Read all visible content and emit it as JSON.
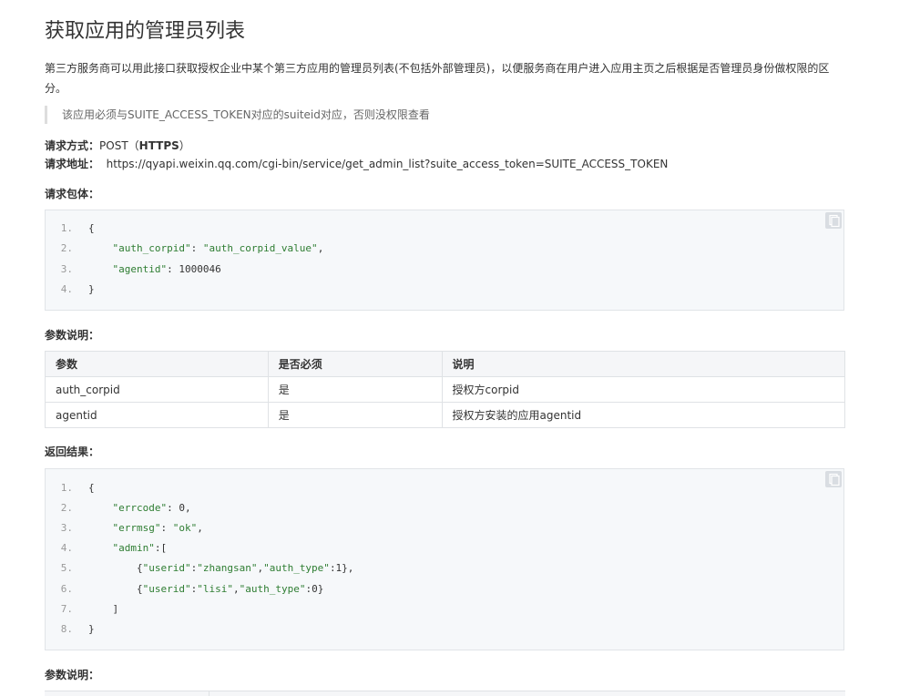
{
  "title": "获取应用的管理员列表",
  "intro": "第三方服务商可以用此接口获取授权企业中某个第三方应用的管理员列表(不包括外部管理员)，以便服务商在用户进入应用主页之后根据是否管理员身份做权限的区分。",
  "note": "该应用必须与SUITE_ACCESS_TOKEN对应的suiteid对应，否则没权限查看",
  "request": {
    "method_label": "请求方式：",
    "method": "POST（",
    "method_proto": "HTTPS",
    "method_close": "）",
    "url_label": "请求地址：",
    "url": "https://qyapi.weixin.qq.com/cgi-bin/service/get_admin_list?suite_access_token=SUITE_ACCESS_TOKEN"
  },
  "body_label": "请求包体：",
  "body_code": [
    {
      "n": "1.",
      "parts": [
        {
          "t": "{",
          "c": "pun"
        }
      ]
    },
    {
      "n": "2.",
      "parts": [
        {
          "t": "    ",
          "c": "pun"
        },
        {
          "t": "\"auth_corpid\"",
          "c": "str"
        },
        {
          "t": ": ",
          "c": "pun"
        },
        {
          "t": "\"auth_corpid_value\"",
          "c": "str"
        },
        {
          "t": ",",
          "c": "pun"
        }
      ]
    },
    {
      "n": "3.",
      "parts": [
        {
          "t": "    ",
          "c": "pun"
        },
        {
          "t": "\"agentid\"",
          "c": "str"
        },
        {
          "t": ": ",
          "c": "pun"
        },
        {
          "t": "1000046",
          "c": "num"
        }
      ]
    },
    {
      "n": "4.",
      "parts": [
        {
          "t": "}",
          "c": "pun"
        }
      ]
    }
  ],
  "params_label": "参数说明：",
  "params_table": {
    "headers": [
      "参数",
      "是否必须",
      "说明"
    ],
    "rows": [
      [
        "auth_corpid",
        "是",
        "授权方corpid"
      ],
      [
        "agentid",
        "是",
        "授权方安装的应用agentid"
      ]
    ]
  },
  "result_label": "返回结果：",
  "result_code": [
    {
      "n": "1.",
      "parts": [
        {
          "t": "{",
          "c": "pun"
        }
      ]
    },
    {
      "n": "2.",
      "parts": [
        {
          "t": "    ",
          "c": "pun"
        },
        {
          "t": "\"errcode\"",
          "c": "str"
        },
        {
          "t": ": 0,",
          "c": "pun"
        }
      ]
    },
    {
      "n": "3.",
      "parts": [
        {
          "t": "    ",
          "c": "pun"
        },
        {
          "t": "\"errmsg\"",
          "c": "str"
        },
        {
          "t": ": ",
          "c": "pun"
        },
        {
          "t": "\"ok\"",
          "c": "str"
        },
        {
          "t": ",",
          "c": "pun"
        }
      ]
    },
    {
      "n": "4.",
      "parts": [
        {
          "t": "    ",
          "c": "pun"
        },
        {
          "t": "\"admin\"",
          "c": "str"
        },
        {
          "t": ":[",
          "c": "pun"
        }
      ]
    },
    {
      "n": "5.",
      "parts": [
        {
          "t": "        {",
          "c": "pun"
        },
        {
          "t": "\"userid\"",
          "c": "str"
        },
        {
          "t": ":",
          "c": "pun"
        },
        {
          "t": "\"zhangsan\"",
          "c": "str"
        },
        {
          "t": ",",
          "c": "pun"
        },
        {
          "t": "\"auth_type\"",
          "c": "str"
        },
        {
          "t": ":1},",
          "c": "pun"
        }
      ]
    },
    {
      "n": "6.",
      "parts": [
        {
          "t": "        {",
          "c": "pun"
        },
        {
          "t": "\"userid\"",
          "c": "str"
        },
        {
          "t": ":",
          "c": "pun"
        },
        {
          "t": "\"lisi\"",
          "c": "str"
        },
        {
          "t": ",",
          "c": "pun"
        },
        {
          "t": "\"auth_type\"",
          "c": "str"
        },
        {
          "t": ":0}",
          "c": "pun"
        }
      ]
    },
    {
      "n": "7.",
      "parts": [
        {
          "t": "    ]",
          "c": "pun"
        }
      ]
    },
    {
      "n": "8.",
      "parts": [
        {
          "t": "}",
          "c": "pun"
        }
      ]
    }
  ],
  "params_label_2": "参数说明：",
  "icons": {
    "copy": "copy-icon"
  },
  "colors": {
    "code_bg": "#f6f8fa",
    "string": "#2e7d32",
    "table_header_bg": "#f5f6f8",
    "border": "#dfe2e5"
  }
}
